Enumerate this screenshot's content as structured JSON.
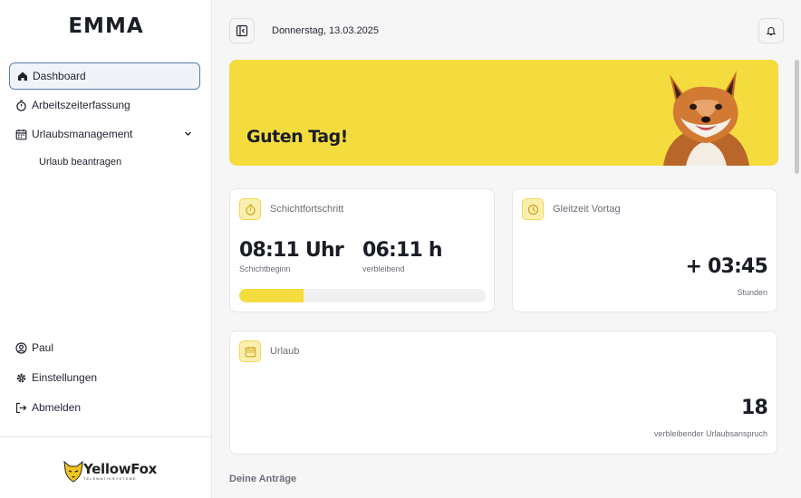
{
  "app": {
    "title": "EMMA"
  },
  "sidebar": {
    "items": [
      {
        "label": "Dashboard",
        "icon": "home-icon",
        "active": true
      },
      {
        "label": "Arbeitszeiterfassung",
        "icon": "stopwatch-icon"
      },
      {
        "label": "Urlaubsmanagement",
        "icon": "calendar-icon",
        "expanded": true,
        "children": [
          {
            "label": "Urlaub beantragen"
          }
        ]
      }
    ],
    "bottom_items": [
      {
        "label": "Paul",
        "icon": "user-circle-icon"
      },
      {
        "label": "Einstellungen",
        "icon": "gear-icon"
      },
      {
        "label": "Abmelden",
        "icon": "logout-icon"
      }
    ],
    "logo": {
      "name": "YellowFox",
      "tagline": "TELEMATIKSYSTEME"
    }
  },
  "header": {
    "date": "Donnerstag, 13.03.2025"
  },
  "hero": {
    "greeting": "Guten Tag!"
  },
  "cards": {
    "shift": {
      "label": "Schichtfortschritt",
      "start_value": "08:11 Uhr",
      "start_caption": "Schichtbeginn",
      "remaining_value": "06:11 h",
      "remaining_caption": "verbleibend",
      "progress": 0.26
    },
    "flextime": {
      "label": "Gleitzeit Vortag",
      "value": "+ 03:45",
      "caption": "Stunden"
    },
    "vacation": {
      "label": "Urlaub",
      "value": "18",
      "caption": "verbleibender Urlaubsanspruch"
    }
  },
  "requests": {
    "title": "Deine Anträge"
  },
  "colors": {
    "accent": "#f4dc3f",
    "active_border": "#5b7ea6"
  }
}
